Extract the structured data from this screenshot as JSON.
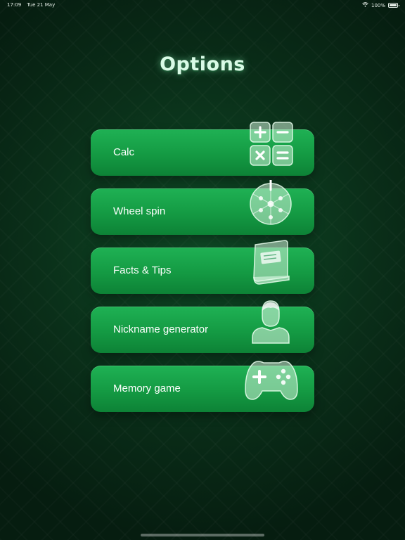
{
  "status_bar": {
    "time": "17:09",
    "date": "Tue 21 May",
    "battery": "100%"
  },
  "title": "Options",
  "menu": [
    {
      "label": "Calc",
      "icon": "calculator-icon"
    },
    {
      "label": "Wheel spin",
      "icon": "wheel-icon"
    },
    {
      "label": "Facts & Tips",
      "icon": "book-icon"
    },
    {
      "label": "Nickname generator",
      "icon": "person-icon"
    },
    {
      "label": "Memory game",
      "icon": "gamepad-icon"
    }
  ],
  "colors": {
    "button": "#17a34a",
    "title": "#d9fbe6",
    "background": "#0a2f19"
  }
}
